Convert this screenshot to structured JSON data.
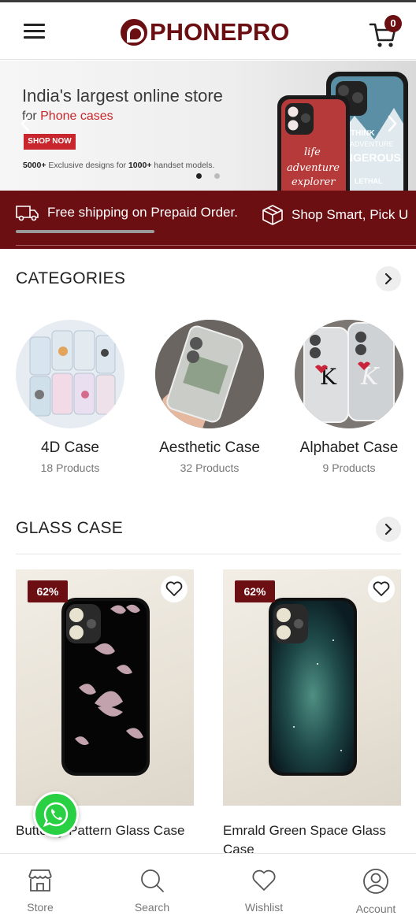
{
  "header": {
    "brand": "PHONEPRO",
    "cart_count": "0"
  },
  "banner": {
    "title": "India's largest online store",
    "subtitle_prefix": "for ",
    "subtitle_highlight": "Phone cases",
    "cta_label": "SHOP NOW",
    "footnote_count1": "5000+",
    "footnote_mid": " Exclusive designs for ",
    "footnote_count2": "1000+",
    "footnote_end": " handset models.",
    "art_text_1": "life adventure explorer",
    "art_text_2": "THINK ADVENTURE DANGEROUS LETHAL",
    "slide_active_index": 0,
    "slide_count": 2
  },
  "shipping_bar": {
    "item1": "Free shipping on Prepaid Order.",
    "item2": "Shop Smart, Pick U"
  },
  "categories": {
    "title": "CATEGORIES",
    "items": [
      {
        "name": "4D Case",
        "count": "18 Products"
      },
      {
        "name": "Aesthetic Case",
        "count": "32 Products"
      },
      {
        "name": "Alphabet Case",
        "count": "9 Products"
      }
    ]
  },
  "glass_case": {
    "title": "GLASS CASE",
    "products": [
      {
        "discount": "62%",
        "title": "Butterfly Pattern Glass Case"
      },
      {
        "discount": "62%",
        "title": "Emrald Green Space Glass Case"
      }
    ]
  },
  "bottom_nav": {
    "items": [
      {
        "label": "Store",
        "icon": "store-icon"
      },
      {
        "label": "Search",
        "icon": "search-icon"
      },
      {
        "label": "Wishlist",
        "icon": "heart-icon"
      },
      {
        "label": "Account",
        "icon": "account-icon"
      }
    ]
  },
  "colors": {
    "brand": "#6b0f12",
    "accent_red": "#c8262c",
    "whatsapp": "#29d044"
  }
}
